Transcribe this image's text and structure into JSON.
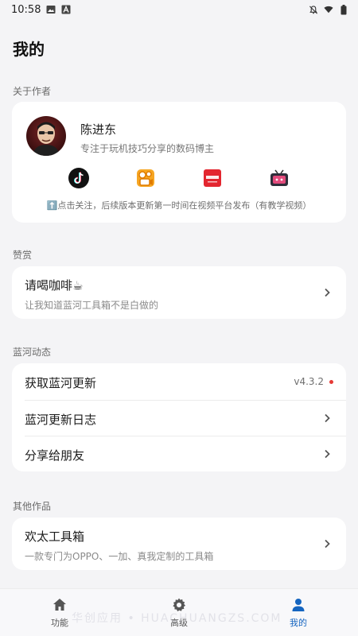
{
  "status_bar": {
    "time": "10:58"
  },
  "page": {
    "title": "我的"
  },
  "sections": {
    "about": "关于作者",
    "praise": "赞赏",
    "news": "蓝河动态",
    "other": "其他作品"
  },
  "author": {
    "name": "陈进东",
    "desc": "专注于玩机技巧分享的数码博主",
    "platforms": [
      "tiktok",
      "kuaishou",
      "xiaohongshu",
      "bilibili"
    ],
    "follow_note": "⬆️点击关注，后续版本更新第一时间在视频平台发布（有教学视频）"
  },
  "praise": {
    "title": "请喝咖啡☕",
    "sub": "让我知道蓝河工具箱不是白做的"
  },
  "news": {
    "update_title": "获取蓝河更新",
    "version": "v4.3.2",
    "changelog_title": "蓝河更新日志",
    "share_title": "分享给朋友"
  },
  "other": {
    "title": "欢太工具箱",
    "sub": "一款专门为OPPO、一加、真我定制的工具箱"
  },
  "nav": {
    "items": [
      {
        "label": "功能",
        "icon": "home-icon"
      },
      {
        "label": "高级",
        "icon": "gear-icon"
      },
      {
        "label": "我的",
        "icon": "person-icon"
      }
    ],
    "active": "我的"
  },
  "watermark": "华创应用 • HUACHUANGZS.COM",
  "colors": {
    "accent": "#1565c0",
    "background": "#f4f4f6",
    "card": "#ffffff",
    "dot": "#e53935"
  }
}
